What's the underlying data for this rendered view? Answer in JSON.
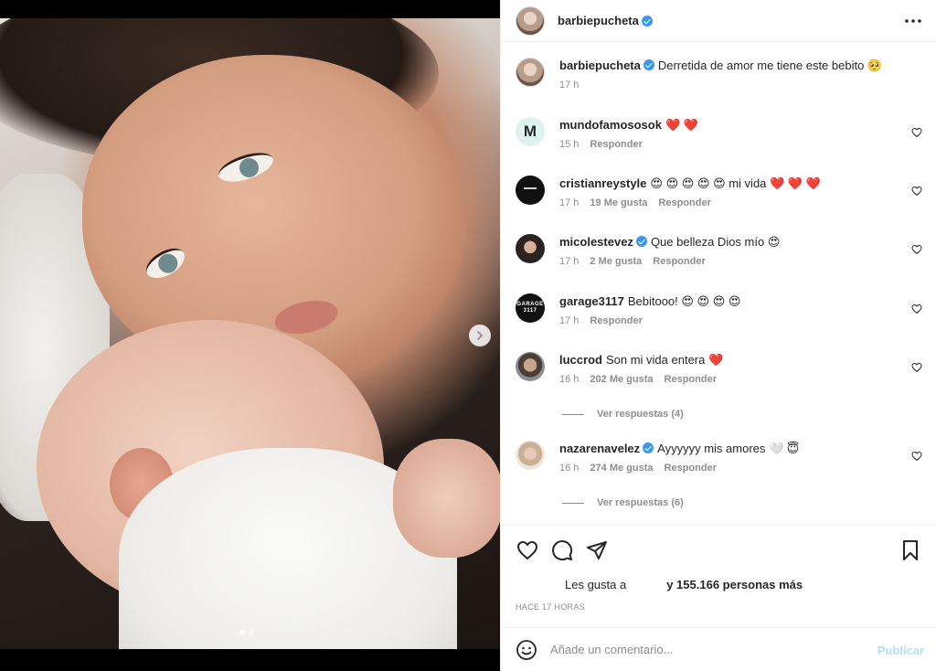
{
  "post": {
    "author": "barbiepucheta",
    "caption": "Derretida de amor me tiene este bebito 🥺",
    "caption_time": "17 h",
    "carousel": {
      "slides": 2,
      "active": 1
    }
  },
  "comments": [
    {
      "user": "mundofamososok",
      "verified": false,
      "avatar_letter": "M",
      "text": "❤️ ❤️",
      "time": "15 h",
      "likes": "",
      "reply": "Responder"
    },
    {
      "user": "cristianreystyle",
      "verified": false,
      "text": "😍 😍 😍 😍 😍 mi vida ❤️ ❤️ ❤️",
      "time": "17 h",
      "likes": "19 Me gusta",
      "reply": "Responder"
    },
    {
      "user": "micolestevez",
      "verified": true,
      "text": "Que belleza Dios mío 😍",
      "time": "17 h",
      "likes": "2 Me gusta",
      "reply": "Responder"
    },
    {
      "user": "garage3117",
      "verified": false,
      "avatar_text": "GARAGE 3117",
      "text": "Bebitooo! 😍 😍 😍 😍",
      "time": "17 h",
      "likes": "",
      "reply": "Responder"
    },
    {
      "user": "luccrod",
      "verified": false,
      "text": "Son mi vida entera ❤️",
      "time": "16 h",
      "likes": "202 Me gusta",
      "reply": "Responder",
      "view_replies": "Ver respuestas (4)"
    },
    {
      "user": "nazarenavelez",
      "verified": true,
      "text": "Ayyyyyy mis amores 🤍 😇",
      "time": "16 h",
      "likes": "274 Me gusta",
      "reply": "Responder",
      "view_replies": "Ver respuestas (6)"
    }
  ],
  "likes": {
    "prefix": "Les gusta a",
    "suffix": "y 155.166 personas más"
  },
  "timestamp": "HACE 17 HORAS",
  "composer": {
    "placeholder": "Añade un comentario...",
    "publish": "Publicar"
  },
  "icons": {
    "more": "more-horizontal-icon",
    "like": "heart-outline-icon",
    "comment": "comment-bubble-icon",
    "share": "paper-plane-icon",
    "save": "bookmark-icon",
    "emoji": "smiley-icon",
    "next": "chevron-right-icon"
  },
  "colors": {
    "verified": "#3897f0",
    "publish_disabled": "#b2dffc",
    "muted": "#8e8e8e",
    "text": "#262626"
  }
}
